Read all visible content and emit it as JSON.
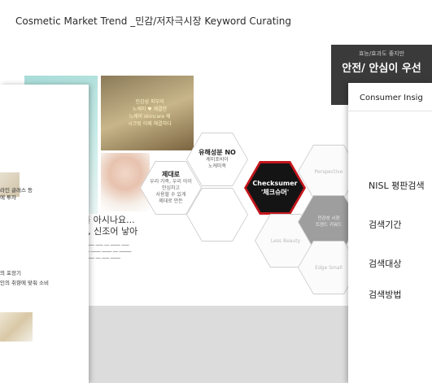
{
  "main_slide": {
    "title": "Cosmetic Market Trend _민감/저자극시장 Keyword Curating",
    "dark_box": {
      "small": "효능/효과도 좋지만",
      "big": "안전/ 안심이 우선"
    },
    "gold_image_text": [
      "민감성 피부의",
      "노케미 ♥ 해결한",
      "노케미 skincare 제",
      "시크릿 이제 해결하다"
    ],
    "hexagons": {
      "checking": {
        "title": "제대로",
        "lines": [
          "우리 가족, 우리 아이",
          "안심하고",
          "사용할 수 있게",
          "제대로 만든"
        ]
      },
      "harmful": {
        "title": "유해성분 NO",
        "lines": [
          "케미포비아",
          "노케미족"
        ]
      },
      "checksumer": {
        "line1": "Checksumer",
        "line2": "'체크슈머'"
      },
      "perspective": "Perspective",
      "less_beauty": "Less Beauty",
      "market": [
        "민감성 시장",
        "트렌드 키워드"
      ],
      "edge_small": "Edge Small"
    },
    "woman_text": [
      "'를 아시나요...",
      "동, 신조어 낳아"
    ],
    "small_lines": [
      "━━━━ ━━━ ━━ ━━━━ ━━━",
      "━━ ━━━━ ━━━━ ━━ ━━━━━",
      "━━━━ ━━ ━━━ ━━━━"
    ]
  },
  "left_slide": {
    "items": [
      "라인 글래스 등",
      "에 투자",
      "의 포장기",
      "인의 취향에 맞춰 소비"
    ]
  },
  "right_slide": {
    "heading": "Consumer Insig",
    "items": [
      "NISL 평판검색",
      "검색기간",
      "검색대상",
      "검색방법"
    ]
  }
}
